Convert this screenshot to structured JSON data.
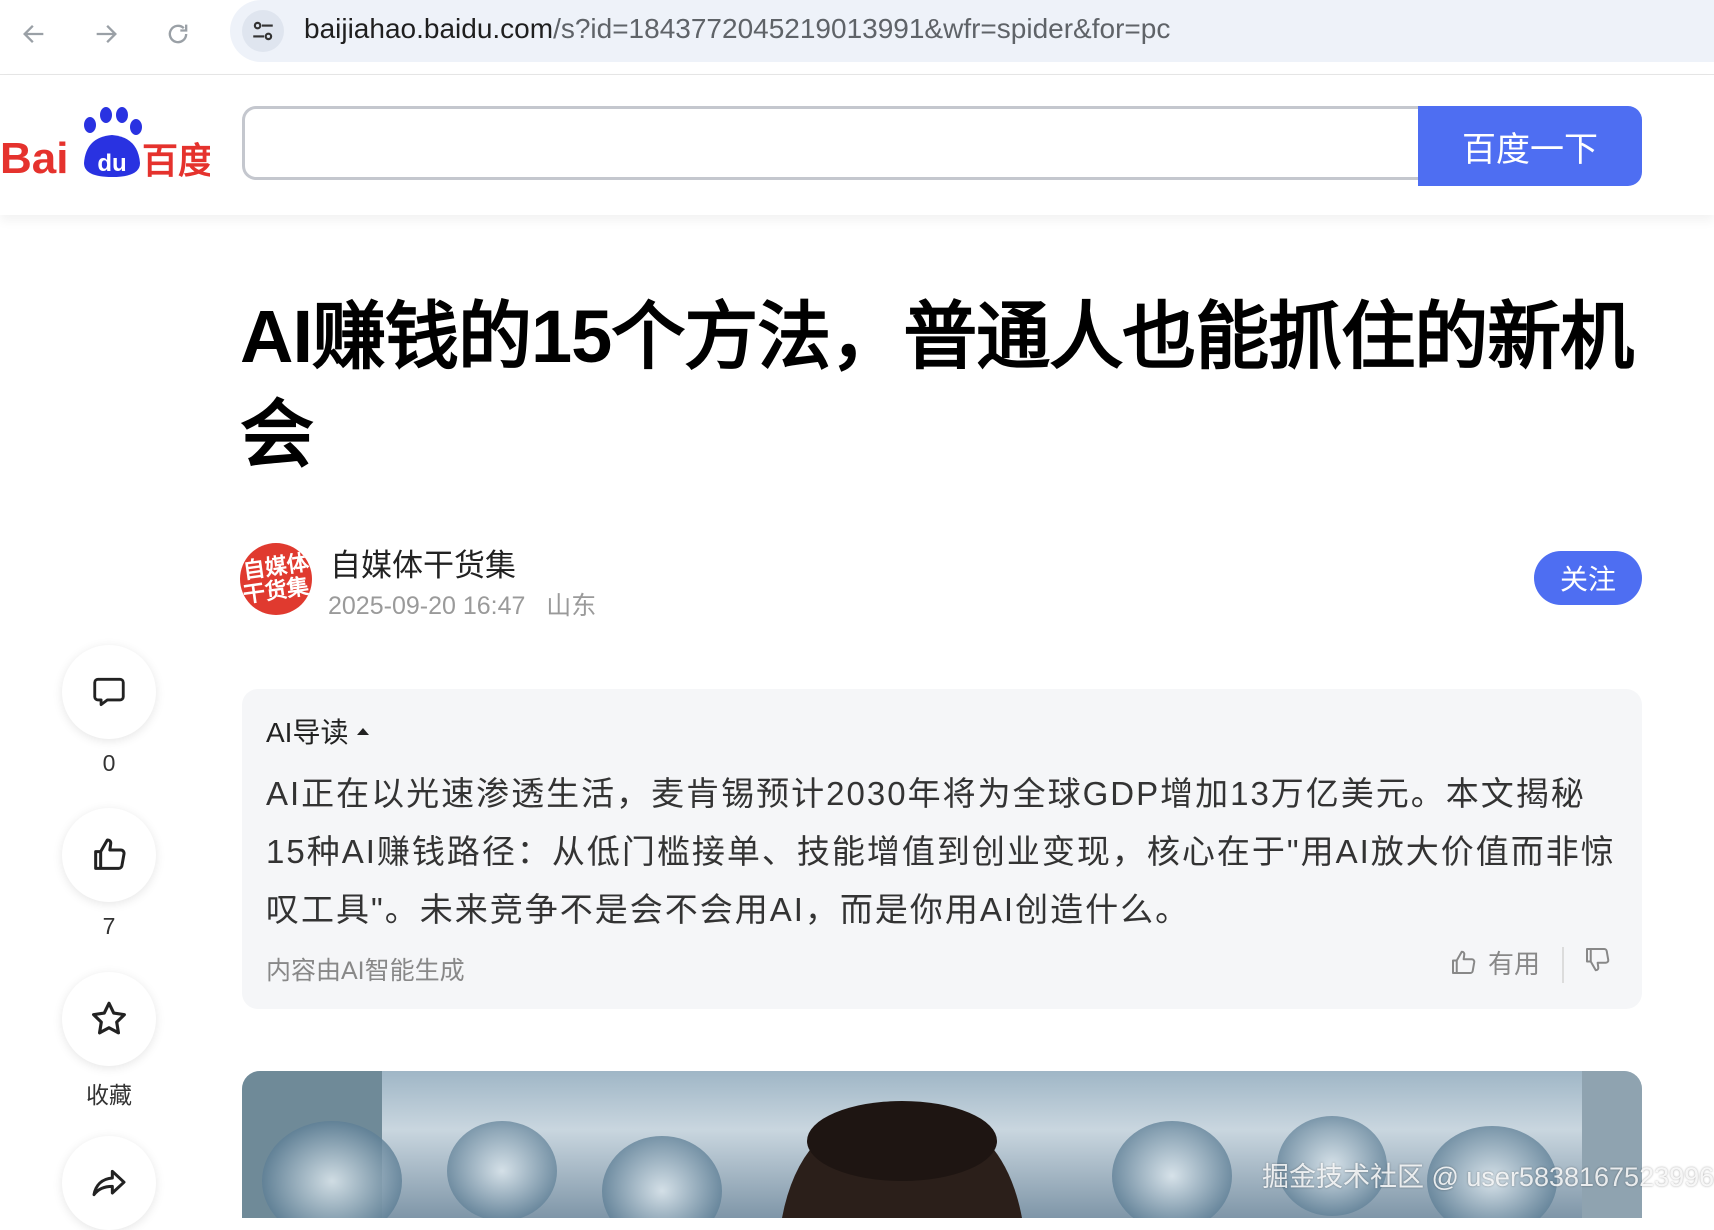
{
  "browser": {
    "url_host": "baijiahao.baidu.com",
    "url_rest": "/s?id=1843772045219013991&wfr=spider&for=pc"
  },
  "header": {
    "logo_text_left": "Bai",
    "logo_text_paw": "du",
    "logo_text_right": "百度",
    "search_value": "",
    "search_button": "百度一下"
  },
  "article": {
    "title": "AI赚钱的15个方法，普通人也能抓住的新机会",
    "author": {
      "avatar_text_line1": "自媒体",
      "avatar_text_line2": "干货集",
      "name": "自媒体干货集",
      "datetime": "2025-09-20 16:47",
      "location": "山东",
      "follow_label": "关注"
    }
  },
  "sidebar": {
    "comment_count": "0",
    "like_count": "7",
    "favorite_label": "收藏"
  },
  "ai_summary": {
    "heading": "AI导读",
    "body": "AI正在以光速渗透生活，麦肯锡预计2030年将为全球GDP增加13万亿美元。本文揭秘15种AI赚钱路径：从低门槛接单、技能增值到创业变现，核心在于\"用AI放大价值而非惊叹工具\"。未来竞争不是会不会用AI，而是你用AI创造什么。",
    "footer_note": "内容由AI智能生成",
    "useful_label": "有用"
  },
  "watermark": "掘金技术社区 @ user5838167523996",
  "colors": {
    "brand_blue": "#4e6ef2",
    "baidu_red": "#e5322d",
    "baidu_blue": "#2932e1"
  }
}
